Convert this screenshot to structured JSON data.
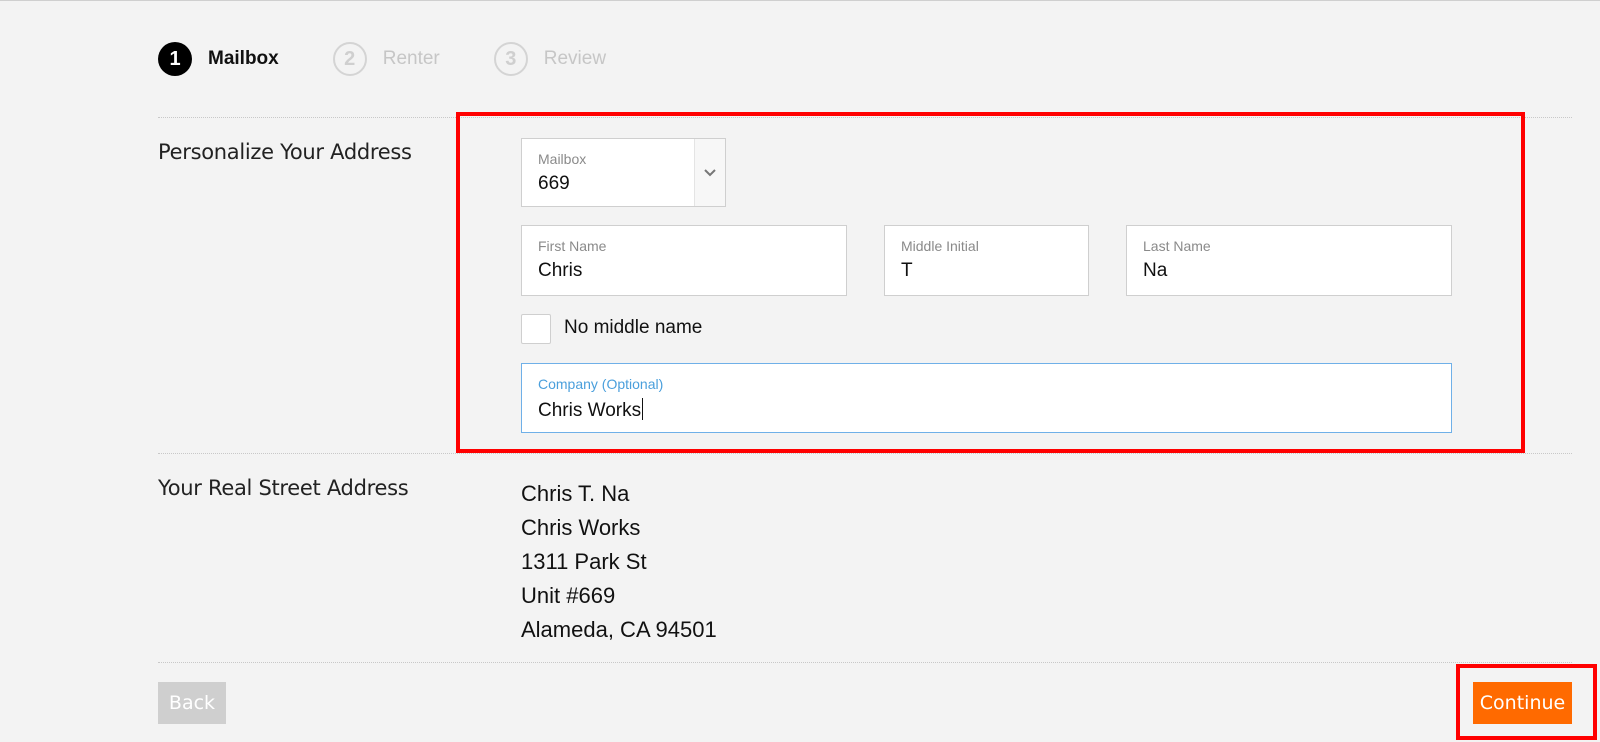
{
  "stepper": {
    "steps": [
      {
        "number": "1",
        "label": "Mailbox",
        "state": "active"
      },
      {
        "number": "2",
        "label": "Renter",
        "state": "inactive"
      },
      {
        "number": "3",
        "label": "Review",
        "state": "inactive"
      }
    ]
  },
  "personalize": {
    "section_title": "Personalize Your Address",
    "mailbox": {
      "label": "Mailbox",
      "value": "669"
    },
    "first_name": {
      "label": "First Name",
      "value": "Chris"
    },
    "middle_initial": {
      "label": "Middle Initial",
      "value": "T"
    },
    "last_name": {
      "label": "Last Name",
      "value": "Na"
    },
    "no_middle_name": {
      "label": "No middle name",
      "checked": false
    },
    "company": {
      "label": "Company (Optional)",
      "value": "Chris Works"
    }
  },
  "real_address": {
    "section_title": "Your Real Street Address",
    "lines": [
      "Chris T. Na",
      "Chris Works",
      "1311 Park St",
      "Unit #669",
      "Alameda, CA 94501"
    ]
  },
  "footer": {
    "back_label": "Back",
    "continue_label": "Continue"
  },
  "colors": {
    "accent": "#ff6a00",
    "highlight": "#ff0000",
    "focus": "#4a9fdc"
  }
}
